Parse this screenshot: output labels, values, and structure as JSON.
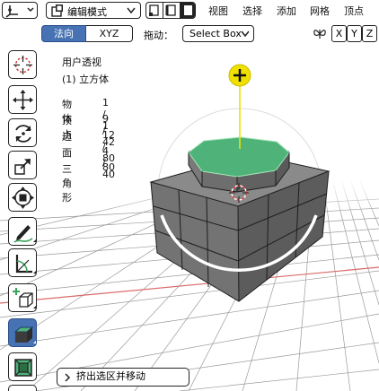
{
  "header": {
    "mode_dropdown": {
      "value": "编辑模式"
    },
    "menus": [
      "视图",
      "选择",
      "添加",
      "网格",
      "顶点"
    ]
  },
  "subheader": {
    "orientation": {
      "active": "法向",
      "inactive": "XYZ"
    },
    "drag_label": "拖动：",
    "drag_select": "Select Box",
    "axis_buttons": [
      "X",
      "Y",
      "Z"
    ]
  },
  "viewport": {
    "view_name": "用户透视",
    "object_name": "(1) 立方体",
    "stats": [
      {
        "label": "物体",
        "value": "1 / 1"
      },
      {
        "label": "顶点",
        "value": "9 / 42"
      },
      {
        "label": "边",
        "value": "12 / 80"
      },
      {
        "label": "面",
        "value": "4 / 40"
      },
      {
        "label": "三角形",
        "value": "80"
      }
    ]
  },
  "toolbar": {
    "tools": [
      "cursor-icon",
      "move-icon",
      "rotate-icon",
      "scale-icon",
      "transform-icon",
      "annotate-icon",
      "measure-icon",
      "add-cube-icon",
      "extrude-region-icon",
      "inset-faces-icon"
    ],
    "active_tool": "extrude-region-icon"
  },
  "operator_panel": {
    "label": "挤出选区并移动"
  },
  "colors": {
    "active_blue": "#4772b3",
    "selected_face": "#4fb379",
    "gizmo_yellow": "#f0e000"
  }
}
